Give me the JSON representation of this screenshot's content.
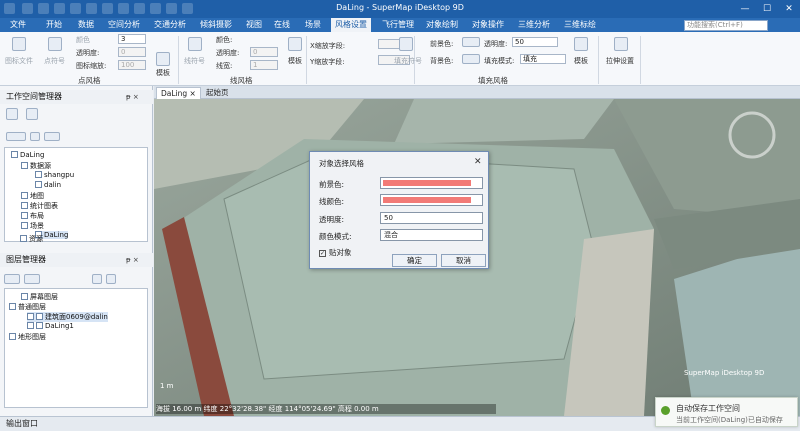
{
  "app": {
    "title": "DaLing - SuperMap iDesktop 9D",
    "minimize": "—",
    "maximize": "☐",
    "close": "✕"
  },
  "menu": [
    "文件",
    "开始",
    "数据",
    "空间分析",
    "交通分析",
    "倾斜摄影",
    "视图",
    "在线",
    "场景",
    "风格设置",
    "飞行管理",
    "对象绘制",
    "对象操作",
    "三维分析",
    "三维标绘"
  ],
  "menu_active_index": 9,
  "search_placeholder": "功能搜索(Ctrl+F)",
  "ribbon": {
    "point_group": {
      "title": "点风格",
      "btn_file": "图标文件",
      "btn_symbol": "点符号",
      "color": "颜色",
      "transparency": "透明度:",
      "scale": "图标缩放:",
      "v_size": "3",
      "v_trans": "0",
      "v_scale": "100"
    },
    "template1": "模板",
    "line_group": {
      "title": "线风格",
      "btn_symbol": "线符号",
      "color": "颜色:",
      "transparency": "透明度:",
      "width": "线宽:",
      "v_trans": "0",
      "v_width": "1"
    },
    "template2": "模板",
    "scale_x": "X缩放字段:",
    "scale_y": "Y缩放字段:",
    "fill_group": {
      "title": "填充风格",
      "btn_symbol": "填充符号",
      "fore": "前景色:",
      "back": "背景色:",
      "transparency": "透明度:",
      "mode": "填充模式:",
      "v_trans": "50",
      "v_mode": "填充"
    },
    "template3": "模板",
    "stretch": "拉伸设置"
  },
  "workspace": {
    "title": "工作空间管理器",
    "pin": "ᵽ ×",
    "items": [
      "DaLing",
      "数据源",
      "shangpu",
      "dalin",
      "地图",
      "统计图表",
      "布局",
      "场景",
      "DaLing",
      "资源"
    ]
  },
  "layers": {
    "title": "图层管理器",
    "pin": "ᵽ ×",
    "items": [
      "屏幕图层",
      "普通图层",
      "建筑面0609@dalin",
      "DaLing1",
      "地形图层"
    ]
  },
  "tabs": [
    "DaLing",
    "起始页"
  ],
  "tab_close": "×",
  "scene_info": {
    "scale": "1 m",
    "bar": "海拔 16.00 m  纬度 22°32'28.38\"  经度 114°05'24.69\"  高程 0.00 m",
    "copy": "SuperMap iDesktop 9D"
  },
  "dialog": {
    "title": "对象选择风格",
    "fore_label": "前景色:",
    "line_label": "线颜色:",
    "trans_label": "透明度:",
    "trans_value": "50",
    "mode_label": "颜色模式:",
    "mode_value": "混合",
    "snap_label": "贴对象",
    "snap_checked": true,
    "ok": "确定",
    "cancel": "取消",
    "close": "✕",
    "swatch": "#f27a76"
  },
  "status": {
    "text": "输出窗口"
  },
  "toast": {
    "title": "自动保存工作空间",
    "body": "当前工作空间(DaLing)已自动保存"
  }
}
